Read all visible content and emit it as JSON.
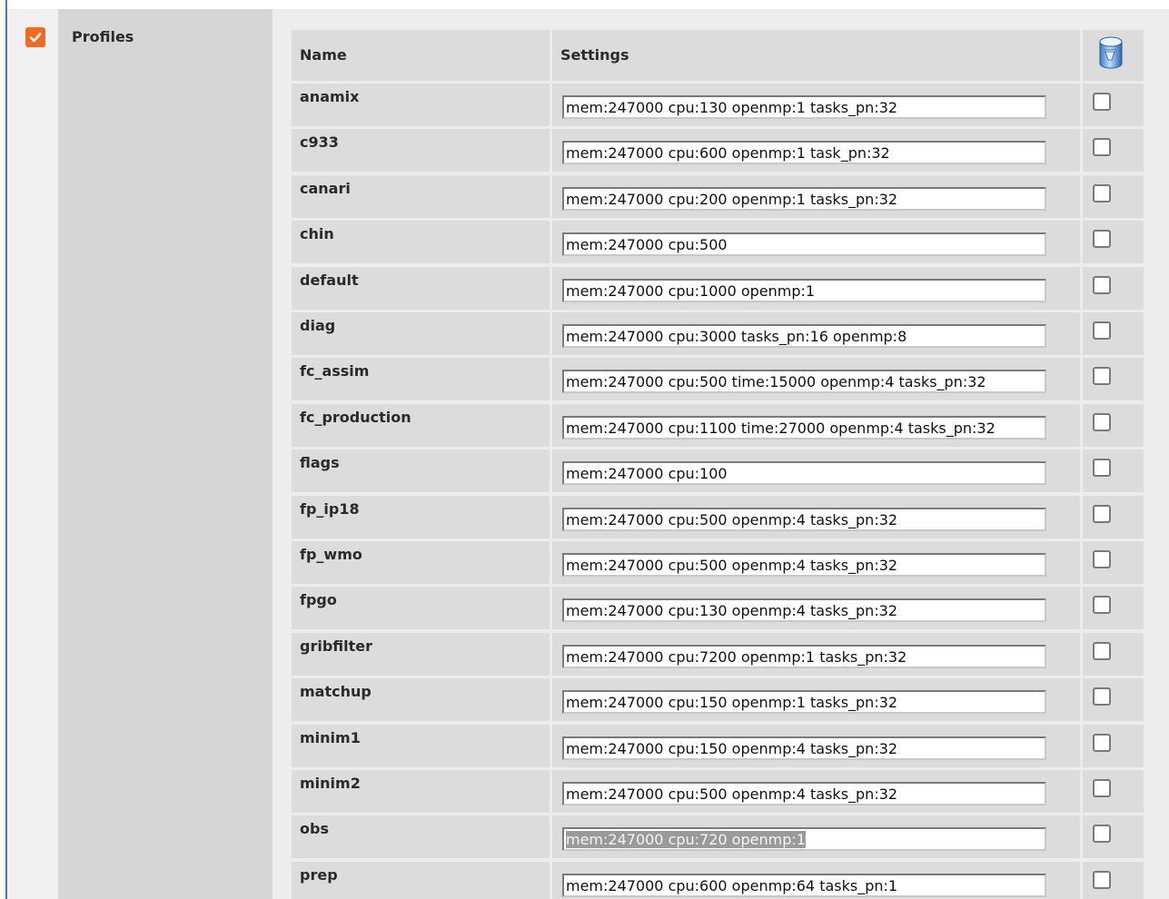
{
  "section": {
    "label": "Profiles",
    "enabled": true,
    "enable_checkbox_color": "#f06a1f"
  },
  "table": {
    "headers": {
      "name": "Name",
      "settings": "Settings",
      "delete_icon": "database-delete-icon"
    },
    "rows": [
      {
        "name": "anamix",
        "settings": "mem:247000 cpu:130 openmp:1 tasks_pn:32",
        "checked": false
      },
      {
        "name": "c933",
        "settings": "mem:247000 cpu:600 openmp:1 task_pn:32",
        "checked": false
      },
      {
        "name": "canari",
        "settings": "mem:247000 cpu:200 openmp:1 tasks_pn:32",
        "checked": false
      },
      {
        "name": "chin",
        "settings": "mem:247000 cpu:500",
        "checked": false
      },
      {
        "name": "default",
        "settings": "mem:247000 cpu:1000 openmp:1",
        "checked": false
      },
      {
        "name": "diag",
        "settings": "mem:247000 cpu:3000 tasks_pn:16 openmp:8",
        "checked": false
      },
      {
        "name": "fc_assim",
        "settings": "mem:247000 cpu:500 time:15000 openmp:4 tasks_pn:32",
        "checked": false
      },
      {
        "name": "fc_production",
        "settings": "mem:247000 cpu:1100 time:27000 openmp:4 tasks_pn:32",
        "checked": false
      },
      {
        "name": "flags",
        "settings": "mem:247000 cpu:100",
        "checked": false
      },
      {
        "name": "fp_ip18",
        "settings": "mem:247000 cpu:500 openmp:4 tasks_pn:32",
        "checked": false
      },
      {
        "name": "fp_wmo",
        "settings": "mem:247000 cpu:500 openmp:4 tasks_pn:32",
        "checked": false
      },
      {
        "name": "fpgo",
        "settings": "mem:247000 cpu:130 openmp:4 tasks_pn:32",
        "checked": false
      },
      {
        "name": "gribfilter",
        "settings": "mem:247000 cpu:7200 openmp:1 tasks_pn:32",
        "checked": false
      },
      {
        "name": "matchup",
        "settings": "mem:247000 cpu:150 openmp:1 tasks_pn:32",
        "checked": false
      },
      {
        "name": "minim1",
        "settings": "mem:247000 cpu:150 openmp:4 tasks_pn:32",
        "checked": false
      },
      {
        "name": "minim2",
        "settings": "mem:247000 cpu:500 openmp:4 tasks_pn:32",
        "checked": false
      },
      {
        "name": "obs",
        "settings": "mem:247000 cpu:720 openmp:1",
        "checked": false,
        "text_selected": true
      },
      {
        "name": "prep",
        "settings": "mem:247000 cpu:600 openmp:64 tasks_pn:1",
        "checked": false
      }
    ]
  }
}
